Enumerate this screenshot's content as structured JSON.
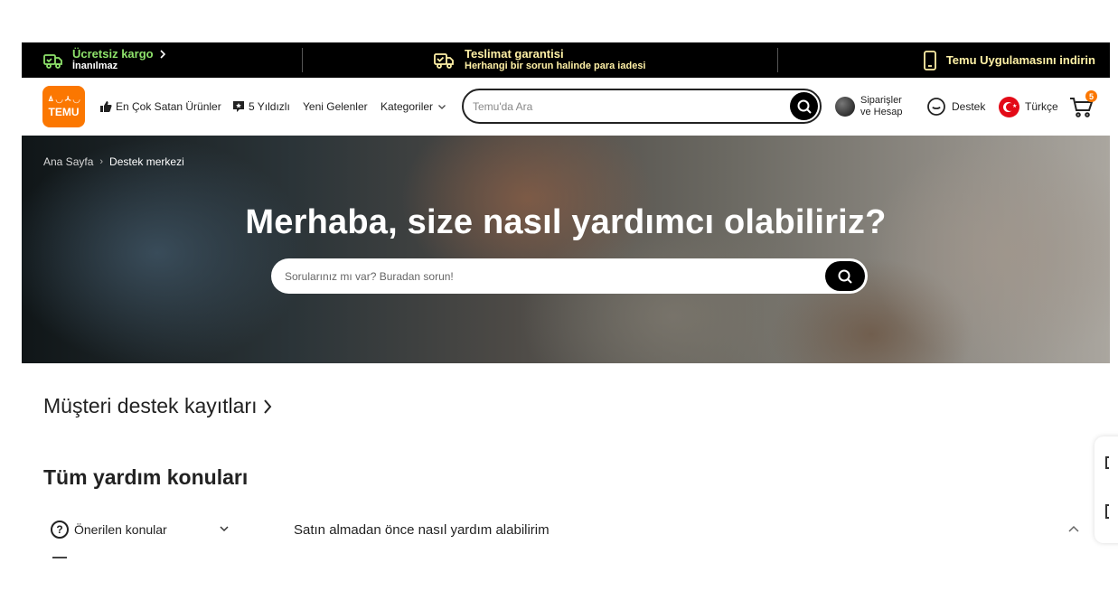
{
  "promo": {
    "shipping_title": "Ücretsiz kargo",
    "shipping_sub": "İnanılmaz",
    "delivery_title": "Teslimat garantisi",
    "delivery_sub": "Herhangi bir sorun halinde para iadesi",
    "app_text": "Temu Uygulamasını indirin"
  },
  "header": {
    "logo_top": "ㅿ◡ㅅ◡",
    "logo_text": "TEMU",
    "nav": {
      "best_sellers": "En Çok Satan Ürünler",
      "five_stars": "5 Yıldızlı",
      "new_arrivals": "Yeni Gelenler",
      "categories": "Kategoriler"
    },
    "search_placeholder": "Temu'da Ara",
    "account_line1": "Siparişler",
    "account_line2": "ve Hesap",
    "support": "Destek",
    "language": "Türkçe",
    "cart_count": "5"
  },
  "hero": {
    "breadcrumb_home": "Ana Sayfa",
    "breadcrumb_sep": "›",
    "breadcrumb_current": "Destek merkezi",
    "title": "Merhaba, size nasıl yardımcı olabiliriz?",
    "search_placeholder": "Sorularınız mı var? Buradan sorun!"
  },
  "content": {
    "records": "Müşteri destek kayıtları",
    "all_topics": "Tüm yardım konuları",
    "recommended": "Önerilen konular",
    "first_question": "Satın almadan önce nasıl yardım alabilirim"
  },
  "colors": {
    "brand_orange": "#fb7701",
    "promo_green": "#8ee26b",
    "promo_yellow": "#fff1a6",
    "flag_red": "#e30a17"
  },
  "icons": {
    "truck": "truck-icon",
    "delivery": "delivery-guarantee-icon",
    "phone": "phone-icon",
    "thumbs_up": "thumbs-up-icon",
    "star_badge": "star-review-icon",
    "search": "search-icon",
    "headset": "chat-support-icon",
    "cart": "cart-icon",
    "question": "question-circle-icon"
  }
}
